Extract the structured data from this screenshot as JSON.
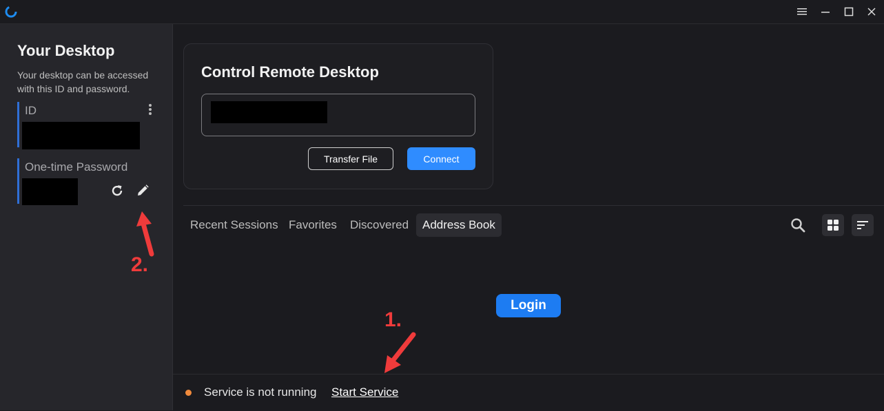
{
  "colors": {
    "accent": "#2f8cff",
    "login": "#1d7cf2",
    "status_dot": "#f08a3c",
    "annotation": "#ef3b3b",
    "sidebar_bar": "#2f6fd6"
  },
  "titlebar": {
    "icons": [
      "app-logo-icon",
      "menu-icon",
      "minimize-icon",
      "maximize-icon",
      "close-icon"
    ]
  },
  "sidebar": {
    "title": "Your Desktop",
    "description": "Your desktop can be accessed with this ID and password.",
    "id_label": "ID",
    "password_label": "One-time Password"
  },
  "connect_card": {
    "title": "Control Remote Desktop",
    "transfer_label": "Transfer File",
    "connect_label": "Connect"
  },
  "tabs": [
    {
      "label": "Recent Sessions",
      "active": false
    },
    {
      "label": "Favorites",
      "active": false
    },
    {
      "label": "Discovered",
      "active": false
    },
    {
      "label": "Address Book",
      "active": true
    }
  ],
  "main": {
    "login_label": "Login"
  },
  "status": {
    "text": "Service is not running",
    "link": "Start Service"
  },
  "annotations": {
    "step1": "1.",
    "step2": "2."
  }
}
